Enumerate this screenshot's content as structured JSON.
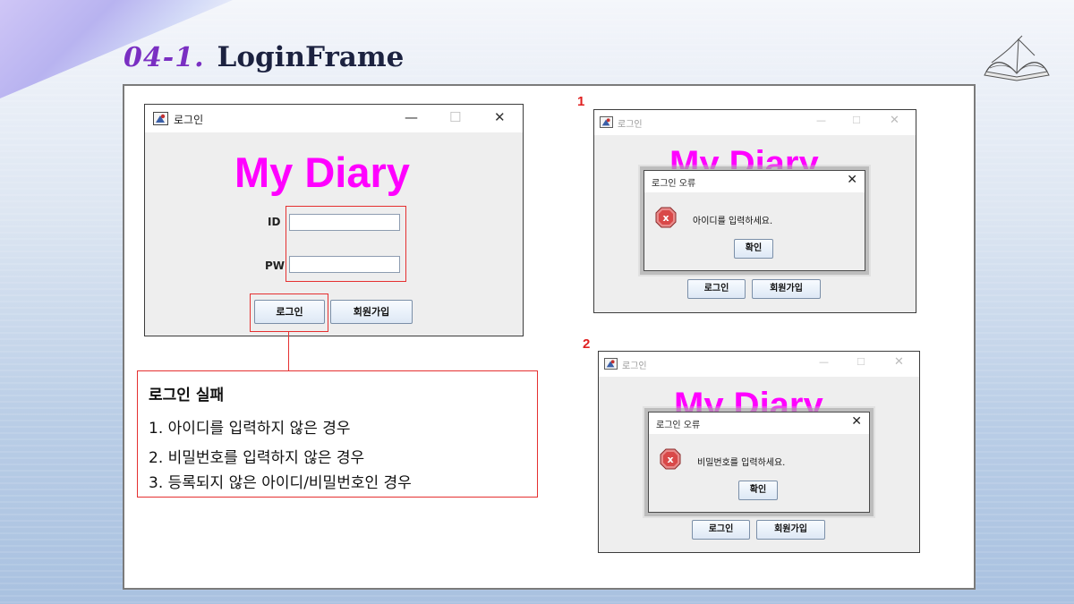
{
  "slide": {
    "section_number": "04-1.",
    "title": "LoginFrame"
  },
  "login_window": {
    "title": "로그인",
    "app_heading": "My Diary",
    "id_label": "ID",
    "pw_label": "PW",
    "id_value": "",
    "pw_value": "",
    "login_button": "로그인",
    "signup_button": "회원가입"
  },
  "callout": {
    "title": "로그인 실패",
    "items": [
      "1.  아이디를 입력하지 않은 경우",
      "2.  비밀번호를 입력하지 않은 경우",
      "3.  등록되지 않은 아이디/비밀번호인 경우"
    ]
  },
  "case1": {
    "marker": "1",
    "window_title": "로그인",
    "app_heading": "My Diary",
    "dialog_title": "로그인 오류",
    "message": "아이디를 입력하세요.",
    "confirm_button": "확인",
    "login_button": "로그인",
    "signup_button": "회원가입"
  },
  "case2": {
    "marker": "2",
    "window_title": "로그인",
    "app_heading": "My Diary",
    "dialog_title": "로그인 오류",
    "message": "비밀번호를 입력하세요.",
    "confirm_button": "확인",
    "login_button": "로그인",
    "signup_button": "회원가입"
  },
  "icons": {
    "window_icon": "java-app-icon",
    "minimize": "minimize-icon",
    "maximize": "maximize-icon",
    "close": "close-icon",
    "error": "error-icon",
    "book": "open-book-icon"
  },
  "colors": {
    "accent_purple": "#7a2fc2",
    "heading_magenta": "#ff00ff",
    "highlight_red": "#e53030"
  }
}
